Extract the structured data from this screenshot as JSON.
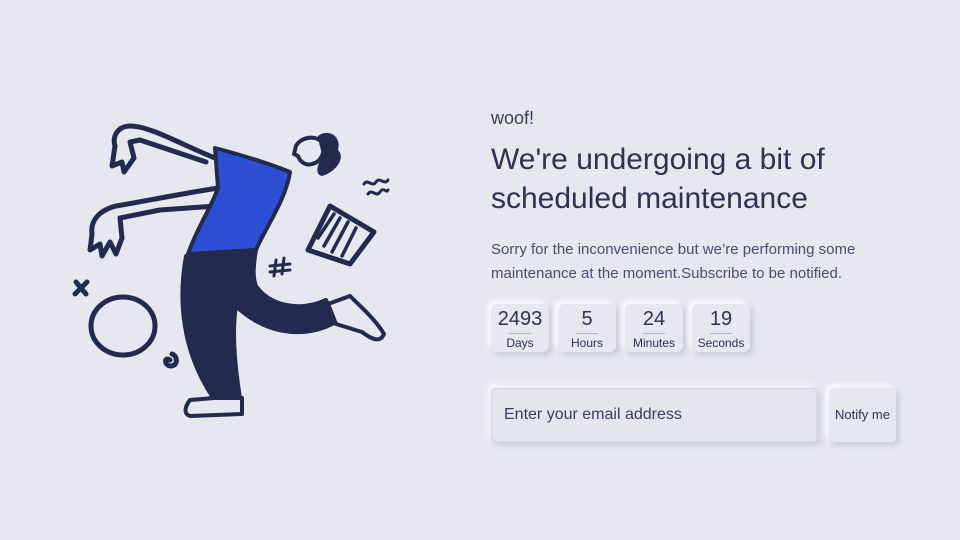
{
  "eyebrow": "woof!",
  "headline": "We're undergoing a bit of scheduled maintenance",
  "subtitle": "Sorry for the inconvenience but we’re performing some maintenance at the moment.Subscribe to be notified.",
  "countdown": [
    {
      "value": "2493",
      "label": "Days"
    },
    {
      "value": "5",
      "label": "Hours"
    },
    {
      "value": "24",
      "label": "Minutes"
    },
    {
      "value": "19",
      "label": "Seconds"
    }
  ],
  "subscribe": {
    "placeholder": "Enter your email address",
    "button_label": "Notify me"
  },
  "colors": {
    "background": "#e6e7ef",
    "text": "#2e3150",
    "accent": "#2c4fd4",
    "ink": "#232a4d"
  }
}
